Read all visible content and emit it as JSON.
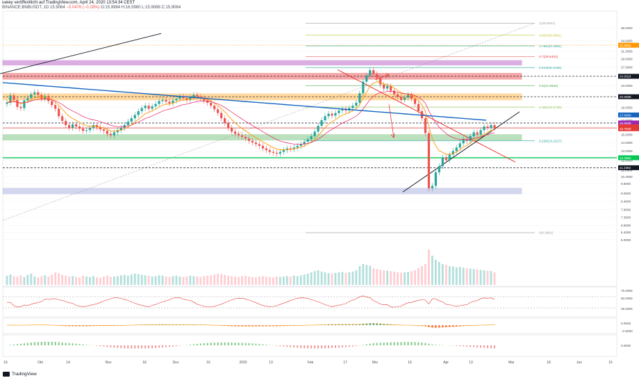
{
  "header": {
    "line1": "iueiey veröffentlicht auf TradingView.com, April 24, 2020 13:54:34 CEST",
    "line2_symbol": "BINANCE:BNBUSDT, 1D 15.9064",
    "line2_change": "−0.0476 (−0.28%)",
    "line2_ohlc": "O:15.9984 H:16.5960 L:15.9088 C:15.9064"
  },
  "footer": {
    "logo_text": "TradingView"
  },
  "colors": {
    "up": "#26a69a",
    "down": "#ef5350",
    "ema200": "#1565c0",
    "ema_short": "#ff9800",
    "trend": "#e53935"
  },
  "chart_data": [
    {
      "type": "candlestick",
      "title": "",
      "symbol": "BINANCE:BNBUSDT",
      "interval": "1D",
      "scale": "log",
      "ylim": [
        4.0,
        44.0
      ],
      "x_ticks": [
        "16",
        "Okt",
        "14",
        "Nov",
        "18",
        "Dez",
        "16",
        "2020",
        "13",
        "Feb",
        "17",
        "Mrz",
        "16",
        "Apr",
        "13",
        "Mai",
        "18",
        "Jun",
        "15"
      ],
      "y_ticks": [
        "38.0000",
        "34.0000",
        "31.0000",
        "29.0000",
        "27.0000",
        "25.0000",
        "23.0000",
        "21.0000",
        "19.0000",
        "17.0000",
        "16.0000",
        "15.0000",
        "14.0000",
        "13.0000",
        "12.0000",
        "11.0000",
        "10.4000",
        "9.8000",
        "9.0000",
        "8.4000",
        "7.8000",
        "7.3000",
        "6.8000",
        "6.4000",
        "6.0000"
      ],
      "price_labels": [
        {
          "text": "32.6931",
          "value": 32.69,
          "color": "#ff9800"
        },
        {
          "text": "24.9324",
          "value": 24.93,
          "color": "#131722"
        },
        {
          "text": "20.8688",
          "value": 20.87,
          "color": "#131722"
        },
        {
          "text": "17.8000",
          "value": 17.8,
          "color": "#1565c0"
        },
        {
          "text": "16.6009",
          "value": 16.6,
          "color": "#9c27b0"
        },
        {
          "text": "−33.7%",
          "value": 16.05,
          "color": "#e53935"
        },
        {
          "text": "15.9064",
          "value": 15.91,
          "color": "#e53935"
        },
        {
          "text": "15.7920",
          "value": 15.79,
          "color": "#e53935"
        },
        {
          "text": "12.2584",
          "value": 12.26,
          "color": "#00c853"
        },
        {
          "text": "11.2382",
          "value": 11.24,
          "color": "#131722"
        }
      ],
      "fib_levels": [
        {
          "text": "1(39.6091)",
          "value": 39.61,
          "color": "#9e9e9e"
        },
        {
          "text": "0.882(35.6881)",
          "value": 35.69,
          "color": "#c0ca33"
        },
        {
          "text": "0.786(32.4981)",
          "value": 32.5,
          "color": "#26a69a"
        },
        {
          "text": "0.7(29.6404)",
          "value": 29.64,
          "color": "#e53935"
        },
        {
          "text": "0.618(26.9156)",
          "value": 26.92,
          "color": "#26a69a"
        },
        {
          "text": "0.5(22.9946)",
          "value": 22.99,
          "color": "#4caf50"
        },
        {
          "text": "0.382(19.0736)",
          "value": 19.07,
          "color": "#8bc34a"
        },
        {
          "text": "0.236(14.2227)",
          "value": 14.22,
          "color": "#26a69a"
        },
        {
          "text": "0(6.3801)",
          "value": 6.38,
          "color": "#9e9e9e"
        }
      ],
      "zones": [
        {
          "from": 27.5,
          "to": 28.6,
          "color": "#ce93d8"
        },
        {
          "from": 24.3,
          "to": 25.6,
          "color": "#f48a8a"
        },
        {
          "from": 20.3,
          "to": 21.4,
          "color": "#ffcc80"
        },
        {
          "from": 14.3,
          "to": 15.0,
          "color": "#a5d6a7"
        },
        {
          "from": 8.95,
          "to": 9.4,
          "color": "#c5cae9"
        }
      ],
      "candles": [
        19.8,
        21.1,
        20.3,
        19.1,
        18.9,
        20.2,
        20.6,
        21.3,
        21.7,
        21.2,
        20.5,
        21.0,
        20.1,
        19.4,
        18.8,
        17.6,
        16.9,
        16.3,
        15.9,
        16.4,
        16.1,
        15.8,
        15.5,
        15.6,
        15.9,
        16.3,
        16.0,
        15.7,
        15.5,
        15.1,
        14.9,
        15.3,
        15.6,
        15.9,
        16.3,
        16.8,
        17.3,
        17.8,
        18.4,
        18.9,
        19.3,
        18.8,
        19.2,
        19.6,
        20.1,
        20.3,
        20.0,
        19.7,
        20.2,
        20.5,
        20.9,
        20.6,
        20.3,
        20.8,
        21.2,
        20.9,
        20.6,
        20.2,
        19.8,
        19.3,
        18.7,
        18.1,
        17.3,
        16.6,
        15.9,
        15.4,
        15.1,
        14.9,
        14.7,
        14.5,
        14.2,
        14.0,
        13.8,
        13.6,
        13.3,
        13.1,
        12.9,
        12.8,
        12.7,
        12.9,
        13.1,
        13.3,
        13.2,
        13.4,
        13.6,
        13.8,
        14.1,
        14.4,
        14.8,
        15.4,
        16.2,
        17.0,
        17.6,
        18.0,
        17.7,
        18.1,
        18.5,
        18.8,
        18.5,
        18.9,
        19.3,
        19.8,
        21.5,
        23.8,
        25.1,
        26.3,
        25.4,
        24.6,
        23.2,
        22.4,
        22.9,
        22.0,
        21.3,
        20.8,
        20.3,
        20.7,
        21.2,
        20.5,
        19.6,
        18.4,
        17.3,
        15.2,
        9.4,
        9.6,
        10.8,
        11.4,
        12.3,
        12.0,
        12.6,
        13.0,
        13.4,
        13.9,
        14.4,
        14.2,
        14.8,
        15.3,
        15.0,
        15.6,
        16.1,
        15.9,
        16.3,
        15.9
      ],
      "volume": [
        0.22,
        0.25,
        0.21,
        0.2,
        0.23,
        0.19,
        0.24,
        0.27,
        0.2,
        0.18,
        0.21,
        0.23,
        0.2,
        0.25,
        0.3,
        0.28,
        0.24,
        0.22,
        0.2,
        0.21,
        0.19,
        0.18,
        0.22,
        0.2,
        0.19,
        0.21,
        0.18,
        0.17,
        0.2,
        0.22,
        0.19,
        0.2,
        0.21,
        0.23,
        0.24,
        0.22,
        0.25,
        0.27,
        0.26,
        0.24,
        0.23,
        0.22,
        0.2,
        0.21,
        0.23,
        0.22,
        0.2,
        0.19,
        0.21,
        0.22,
        0.2,
        0.19,
        0.2,
        0.22,
        0.21,
        0.2,
        0.19,
        0.21,
        0.22,
        0.23,
        0.25,
        0.27,
        0.26,
        0.24,
        0.22,
        0.21,
        0.2,
        0.19,
        0.21,
        0.22,
        0.2,
        0.19,
        0.18,
        0.2,
        0.21,
        0.2,
        0.19,
        0.18,
        0.2,
        0.19,
        0.2,
        0.21,
        0.2,
        0.22,
        0.21,
        0.23,
        0.25,
        0.27,
        0.3,
        0.33,
        0.35,
        0.32,
        0.3,
        0.28,
        0.27,
        0.29,
        0.3,
        0.31,
        0.29,
        0.3,
        0.32,
        0.35,
        0.45,
        0.5,
        0.48,
        0.46,
        0.4,
        0.38,
        0.36,
        0.35,
        0.34,
        0.33,
        0.32,
        0.3,
        0.29,
        0.3,
        0.31,
        0.33,
        0.35,
        0.4,
        0.45,
        0.5,
        0.85,
        0.7,
        0.6,
        0.55,
        0.5,
        0.48,
        0.45,
        0.44,
        0.42,
        0.43,
        0.41,
        0.4,
        0.39,
        0.38,
        0.37,
        0.36,
        0.35,
        0.34,
        0.33,
        0.3
      ],
      "osc1_ticks": [
        "75.0000",
        "50.0000",
        "25.0000"
      ],
      "osc2_ticks": [
        "0.0000",
        "−2.5000"
      ],
      "osc3_ticks": [
        "0.0000"
      ]
    }
  ]
}
